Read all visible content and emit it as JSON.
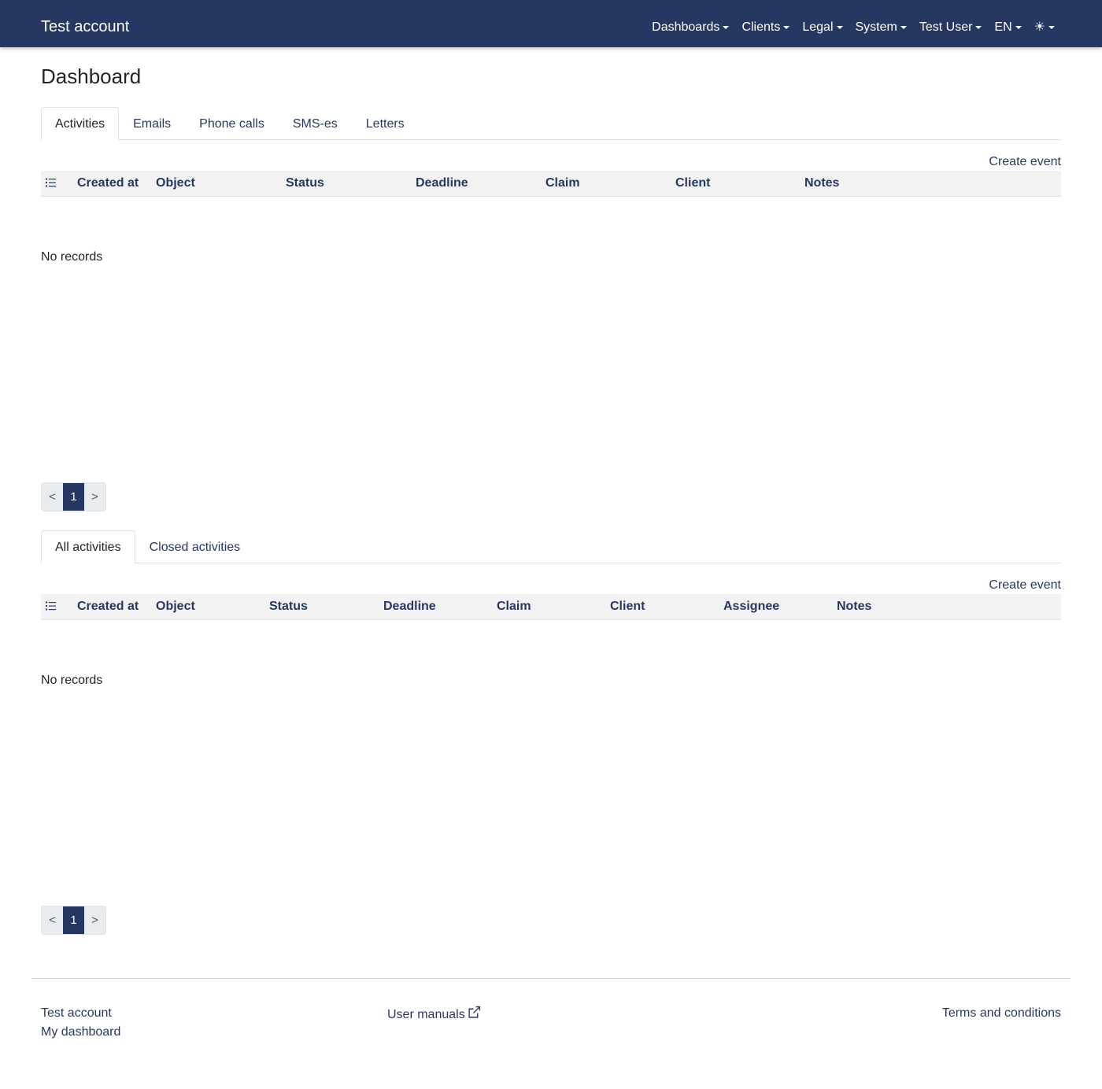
{
  "navbar": {
    "brand": "Test account",
    "items": [
      {
        "label": "Dashboards"
      },
      {
        "label": "Clients"
      },
      {
        "label": "Legal"
      },
      {
        "label": "System"
      },
      {
        "label": "Test User"
      },
      {
        "label": "EN"
      }
    ],
    "theme_icon": "sun-icon",
    "theme_glyph": "☀"
  },
  "page": {
    "title": "Dashboard"
  },
  "section1": {
    "tabs": [
      "Activities",
      "Emails",
      "Phone calls",
      "SMS-es",
      "Letters"
    ],
    "active_tab": 0,
    "create_label": "Create event",
    "columns": [
      "Created at",
      "Object",
      "Status",
      "Deadline",
      "Claim",
      "Client",
      "Notes"
    ],
    "empty_text": "No records",
    "pager": {
      "prev": "<",
      "page": "1",
      "next": ">"
    }
  },
  "section2": {
    "tabs": [
      "All activities",
      "Closed activities"
    ],
    "active_tab": 0,
    "create_label": "Create event",
    "columns": [
      "Created at",
      "Object",
      "Status",
      "Deadline",
      "Claim",
      "Client",
      "Assignee",
      "Notes"
    ],
    "empty_text": "No records",
    "pager": {
      "prev": "<",
      "page": "1",
      "next": ">"
    }
  },
  "footer": {
    "brand": "Test account",
    "dashboard": "My dashboard",
    "manuals": "User manuals",
    "manuals_icon": "external-link-icon",
    "terms": "Terms and conditions"
  },
  "colors": {
    "primary": "#263862",
    "header_bg": "#f2f2f2",
    "border": "#dee2e6"
  }
}
